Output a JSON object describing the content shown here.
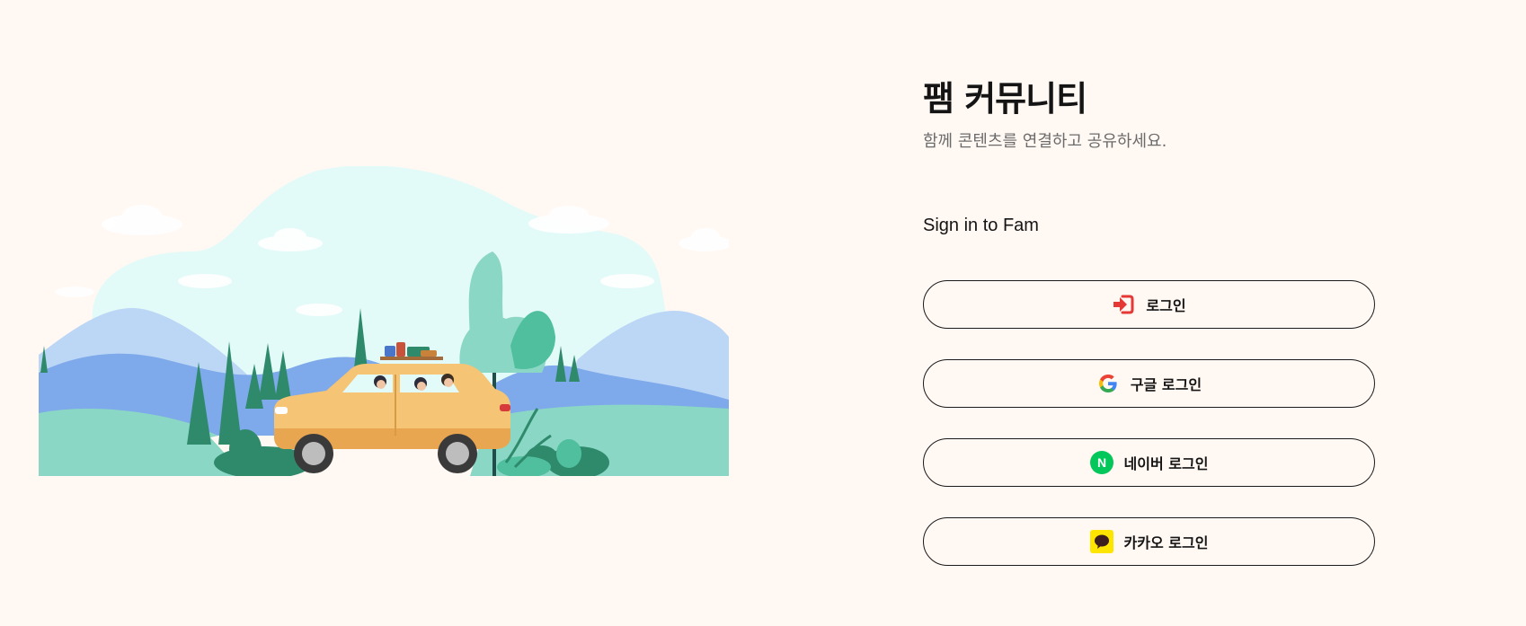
{
  "header": {
    "title": "팸 커뮤니티",
    "subtitle": "함께 콘텐츠를 연결하고 공유하세요."
  },
  "signin": {
    "heading": "Sign in to Fam"
  },
  "buttons": {
    "login": {
      "label": "로그인",
      "icon": "sign-in-icon",
      "icon_color": "#e53935"
    },
    "google": {
      "label": "구글 로그인",
      "icon": "google-icon"
    },
    "naver": {
      "label": "네이버 로그인",
      "icon": "naver-icon",
      "icon_letter": "N",
      "icon_color": "#03c75a"
    },
    "kakao": {
      "label": "카카오 로그인",
      "icon": "kakao-icon",
      "icon_color": "#fee500"
    }
  },
  "colors": {
    "background": "#fff8f3",
    "border": "#1a1a1a",
    "subtitle": "#6b6b6b"
  }
}
